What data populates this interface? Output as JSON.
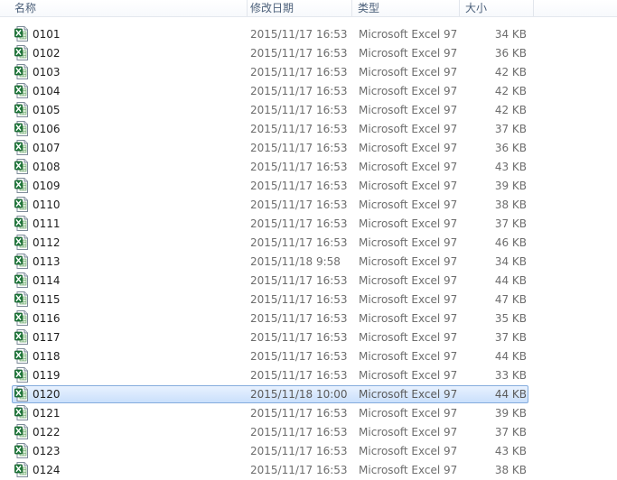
{
  "columns": {
    "name": "名称",
    "date": "修改日期",
    "type": "类型",
    "size": "大小"
  },
  "icon": "excel-file-icon",
  "selected_name": "0120",
  "files": [
    {
      "name": "0101",
      "date": "2015/11/17 16:53",
      "type": "Microsoft Excel 97...",
      "size": "34 KB"
    },
    {
      "name": "0102",
      "date": "2015/11/17 16:53",
      "type": "Microsoft Excel 97...",
      "size": "36 KB"
    },
    {
      "name": "0103",
      "date": "2015/11/17 16:53",
      "type": "Microsoft Excel 97...",
      "size": "42 KB"
    },
    {
      "name": "0104",
      "date": "2015/11/17 16:53",
      "type": "Microsoft Excel 97...",
      "size": "42 KB"
    },
    {
      "name": "0105",
      "date": "2015/11/17 16:53",
      "type": "Microsoft Excel 97...",
      "size": "42 KB"
    },
    {
      "name": "0106",
      "date": "2015/11/17 16:53",
      "type": "Microsoft Excel 97...",
      "size": "37 KB"
    },
    {
      "name": "0107",
      "date": "2015/11/17 16:53",
      "type": "Microsoft Excel 97...",
      "size": "36 KB"
    },
    {
      "name": "0108",
      "date": "2015/11/17 16:53",
      "type": "Microsoft Excel 97...",
      "size": "43 KB"
    },
    {
      "name": "0109",
      "date": "2015/11/17 16:53",
      "type": "Microsoft Excel 97...",
      "size": "39 KB"
    },
    {
      "name": "0110",
      "date": "2015/11/17 16:53",
      "type": "Microsoft Excel 97...",
      "size": "38 KB"
    },
    {
      "name": "0111",
      "date": "2015/11/17 16:53",
      "type": "Microsoft Excel 97...",
      "size": "37 KB"
    },
    {
      "name": "0112",
      "date": "2015/11/17 16:53",
      "type": "Microsoft Excel 97...",
      "size": "46 KB"
    },
    {
      "name": "0113",
      "date": "2015/11/18 9:58",
      "type": "Microsoft Excel 97...",
      "size": "34 KB"
    },
    {
      "name": "0114",
      "date": "2015/11/17 16:53",
      "type": "Microsoft Excel 97...",
      "size": "44 KB"
    },
    {
      "name": "0115",
      "date": "2015/11/17 16:53",
      "type": "Microsoft Excel 97...",
      "size": "47 KB"
    },
    {
      "name": "0116",
      "date": "2015/11/17 16:53",
      "type": "Microsoft Excel 97...",
      "size": "35 KB"
    },
    {
      "name": "0117",
      "date": "2015/11/17 16:53",
      "type": "Microsoft Excel 97...",
      "size": "37 KB"
    },
    {
      "name": "0118",
      "date": "2015/11/17 16:53",
      "type": "Microsoft Excel 97...",
      "size": "44 KB"
    },
    {
      "name": "0119",
      "date": "2015/11/17 16:53",
      "type": "Microsoft Excel 97...",
      "size": "33 KB"
    },
    {
      "name": "0120",
      "date": "2015/11/18 10:00",
      "type": "Microsoft Excel 97...",
      "size": "44 KB"
    },
    {
      "name": "0121",
      "date": "2015/11/17 16:53",
      "type": "Microsoft Excel 97...",
      "size": "39 KB"
    },
    {
      "name": "0122",
      "date": "2015/11/17 16:53",
      "type": "Microsoft Excel 97...",
      "size": "37 KB"
    },
    {
      "name": "0123",
      "date": "2015/11/17 16:53",
      "type": "Microsoft Excel 97...",
      "size": "43 KB"
    },
    {
      "name": "0124",
      "date": "2015/11/17 16:53",
      "type": "Microsoft Excel 97...",
      "size": "38 KB"
    }
  ]
}
